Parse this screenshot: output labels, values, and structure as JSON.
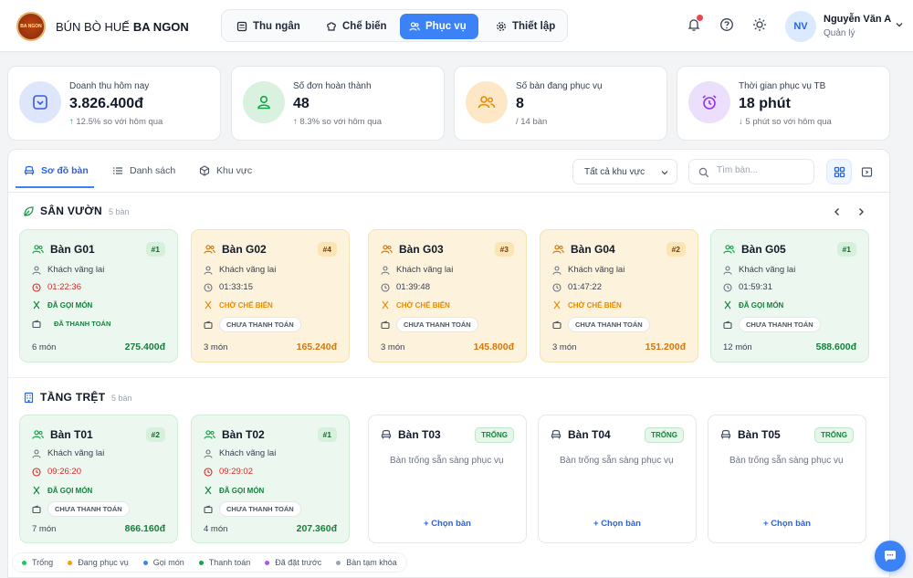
{
  "app": {
    "brand_light": "BÚN BÒ HUẾ",
    "brand_bold": "BA NGON",
    "logo_text": "BA NGON"
  },
  "nav": {
    "items": [
      {
        "label": "Thu ngân",
        "icon": "cash-register-icon"
      },
      {
        "label": "Chế biến",
        "icon": "chef-hat-icon"
      },
      {
        "label": "Phục vụ",
        "icon": "users-icon",
        "active": true
      },
      {
        "label": "Thiết lập",
        "icon": "gear-icon"
      }
    ]
  },
  "user": {
    "initials": "NV",
    "name": "Nguyễn Văn A",
    "role": "Quản lý"
  },
  "stats": [
    {
      "label": "Doanh thu hôm nay",
      "value": "3.826.400đ",
      "change": "12.5%",
      "change_dir": "up",
      "suffix": "so với hôm qua"
    },
    {
      "label": "Số đơn hoàn thành",
      "value": "48",
      "change": "8.3%",
      "change_dir": "up",
      "suffix": "so với hôm qua"
    },
    {
      "label": "Số bàn đang phục vụ",
      "value": "8",
      "note": "/ 14 bàn"
    },
    {
      "label": "Thời gian phục vụ TB",
      "value": "18 phút",
      "change": "5 phút",
      "change_dir": "down",
      "suffix": "so với hôm qua"
    }
  ],
  "tabs": [
    {
      "label": "Sơ đồ bàn",
      "active": true
    },
    {
      "label": "Danh sách"
    },
    {
      "label": "Khu vực"
    }
  ],
  "filter": {
    "area_select": "Tất cả khu vực",
    "search_placeholder": "Tìm bàn..."
  },
  "areas": [
    {
      "title": "SÂN VƯỜN",
      "count": "5 bàn",
      "tables": [
        {
          "name": "Bàn G01",
          "badge": "#1",
          "guest": "Khách vãng lai",
          "time": "01:22:36",
          "order": "ĐÃ GỌI MÓN",
          "payment": "ĐÃ THANH TOÁN",
          "items": "6 món",
          "total": "275.400đ"
        },
        {
          "name": "Bàn G02",
          "badge": "#4",
          "guest": "Khách vãng lai",
          "time": "01:33:15",
          "order": "CHỜ CHẾ BIẾN",
          "payment": "CHƯA THANH TOÁN",
          "items": "3 món",
          "total": "165.240đ"
        },
        {
          "name": "Bàn G03",
          "badge": "#3",
          "guest": "Khách vãng lai",
          "time": "01:39:48",
          "order": "CHỜ CHẾ BIẾN",
          "payment": "CHƯA THANH TOÁN",
          "items": "3 món",
          "total": "145.800đ"
        },
        {
          "name": "Bàn G04",
          "badge": "#2",
          "guest": "Khách vãng lai",
          "time": "01:47:22",
          "order": "CHỜ CHẾ BIẾN",
          "payment": "CHƯA THANH TOÁN",
          "items": "3 món",
          "total": "151.200đ"
        },
        {
          "name": "Bàn G05",
          "badge": "#1",
          "guest": "Khách vãng lai",
          "time": "01:59:31",
          "order": "ĐÃ GỌI MÓN",
          "payment": "CHƯA THANH TOÁN",
          "items": "12 món",
          "total": "588.600đ"
        }
      ]
    },
    {
      "title": "TẦNG TRỆT",
      "count": "5 bàn",
      "tables": [
        {
          "name": "Bàn T01",
          "badge": "#2",
          "guest": "Khách vãng lai",
          "time": "09:26:20",
          "order": "ĐÃ GỌI MÓN",
          "payment": "CHƯA THANH TOÁN",
          "items": "7 món",
          "total": "866.160đ"
        },
        {
          "name": "Bàn T02",
          "badge": "#1",
          "guest": "Khách vãng lai",
          "time": "09:29:02",
          "order": "ĐÃ GỌI MÓN",
          "payment": "CHƯA THANH TOÁN",
          "items": "4 món",
          "total": "207.360đ"
        },
        {
          "name": "Bàn T03",
          "badge": "TRỐNG",
          "empty_text": "Bàn trống sẵn sàng phục vụ",
          "action": "Chọn bàn"
        },
        {
          "name": "Bàn T04",
          "badge": "TRỐNG",
          "empty_text": "Bàn trống sẵn sàng phục vụ",
          "action": "Chọn bàn"
        },
        {
          "name": "Bàn T05",
          "badge": "TRỐNG",
          "empty_text": "Bàn trống sẵn sàng phục vụ",
          "action": "Chọn bàn"
        }
      ]
    }
  ],
  "legend": [
    {
      "label": "Trống",
      "color": "#22c55e"
    },
    {
      "label": "Đang phục vụ",
      "color": "#f59e0b"
    },
    {
      "label": "Gọi món",
      "color": "#3b82f6"
    },
    {
      "label": "Thanh toán",
      "color": "#16a34a"
    },
    {
      "label": "Đã đặt trước",
      "color": "#a855f7"
    },
    {
      "label": "Bàn tạm khóa",
      "color": "#9ca3af"
    }
  ],
  "colors": {
    "accent": "#3b82f6",
    "green": "#15803d",
    "amber": "#d97706",
    "red": "#dc2626"
  }
}
